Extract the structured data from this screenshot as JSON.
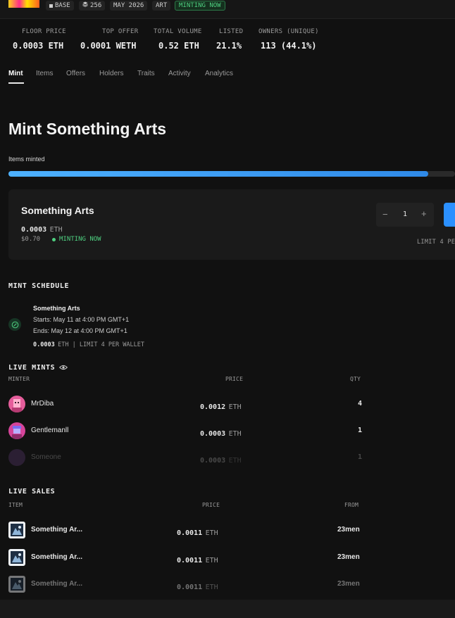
{
  "header": {
    "chain": "BASE",
    "supply": "256",
    "date": "MAY 2026",
    "category": "ART",
    "status": "MINTING NOW"
  },
  "stats": [
    {
      "label": "FLOOR PRICE",
      "value": "0.0003 ETH"
    },
    {
      "label": "TOP OFFER",
      "value": "0.0001 WETH"
    },
    {
      "label": "TOTAL VOLUME",
      "value": "0.52 ETH"
    },
    {
      "label": "LISTED",
      "value": "21.1%"
    },
    {
      "label": "OWNERS (UNIQUE)",
      "value": "113 (44.1%)"
    }
  ],
  "tabs": [
    "Mint",
    "Items",
    "Offers",
    "Holders",
    "Traits",
    "Activity",
    "Analytics"
  ],
  "mint": {
    "title": "Mint Something Arts",
    "progress_label": "Items minted",
    "progress_fraction": 0.94,
    "card": {
      "name": "Something Arts",
      "price": "0.0003",
      "unit": "ETH",
      "usd": "$0.70",
      "status": "MINTING NOW",
      "quantity": "1",
      "minus": "−",
      "plus": "+",
      "limit": "LIMIT 4 PE"
    }
  },
  "schedule": {
    "heading": "MINT SCHEDULE",
    "name": "Something Arts",
    "starts": "Starts: May 11 at 4:00 PM GMT+1",
    "ends": "Ends: May 12 at 4:00 PM GMT+1",
    "price": "0.0003",
    "suffix": "ETH | LIMIT 4 PER WALLET"
  },
  "live_mints": {
    "heading": "LIVE MINTS",
    "columns": {
      "minter": "MINTER",
      "price": "PRICE",
      "qty": "QTY"
    },
    "rows": [
      {
        "name": "MrDiba",
        "price": "0.0012",
        "unit": "ETH",
        "qty": "4"
      },
      {
        "name": "Gentlemanll",
        "price": "0.0003",
        "unit": "ETH",
        "qty": "1"
      },
      {
        "name": "Someone",
        "price": "0.0003",
        "unit": "ETH",
        "qty": "1"
      }
    ]
  },
  "live_sales": {
    "heading": "LIVE SALES",
    "columns": {
      "item": "ITEM",
      "price": "PRICE",
      "from": "FROM"
    },
    "rows": [
      {
        "item": "Something Ar...",
        "price": "0.0011",
        "unit": "ETH",
        "from": "23men"
      },
      {
        "item": "Something Ar...",
        "price": "0.0011",
        "unit": "ETH",
        "from": "23men"
      },
      {
        "item": "Something Ar...",
        "price": "0.0011",
        "unit": "ETH",
        "from": "23men"
      }
    ]
  },
  "colors": {
    "accent": "#2b90ff",
    "green": "#4ed080",
    "background": "#111111"
  }
}
